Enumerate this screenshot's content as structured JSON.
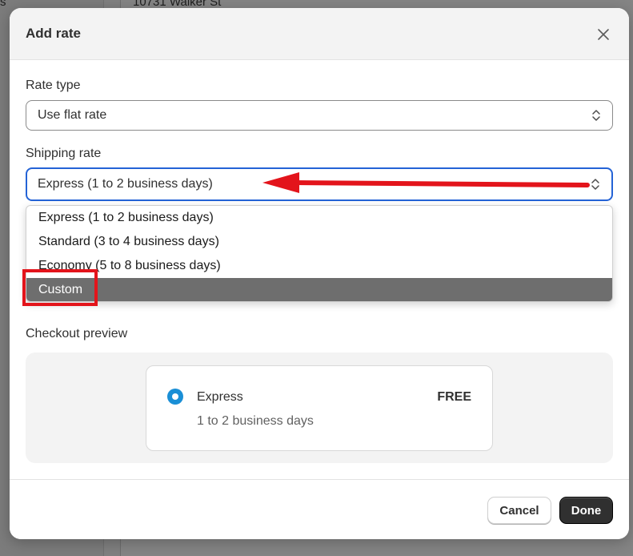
{
  "background": {
    "address_snippet": "10731 Walker St",
    "left_snippet": "s"
  },
  "modal": {
    "title": "Add rate",
    "close_icon": "close-icon",
    "rate_type": {
      "label": "Rate type",
      "value": "Use flat rate"
    },
    "shipping_rate": {
      "label": "Shipping rate",
      "value": "Express (1 to 2 business days)",
      "options": [
        "Express (1 to 2 business days)",
        "Standard (3 to 4 business days)",
        "Economy (5 to 8 business days)",
        "Custom"
      ],
      "highlighted_option": "Custom"
    },
    "checkout_preview": {
      "label": "Checkout preview",
      "name": "Express",
      "price": "FREE",
      "subtitle": "1 to 2 business days"
    },
    "footer": {
      "cancel_label": "Cancel",
      "done_label": "Done"
    }
  },
  "colors": {
    "focus_border": "#2463d6",
    "radio": "#1a8fd6",
    "annotation": "#e3141b",
    "highlight_option": "#6e6e6e",
    "primary_button": "#303030"
  }
}
